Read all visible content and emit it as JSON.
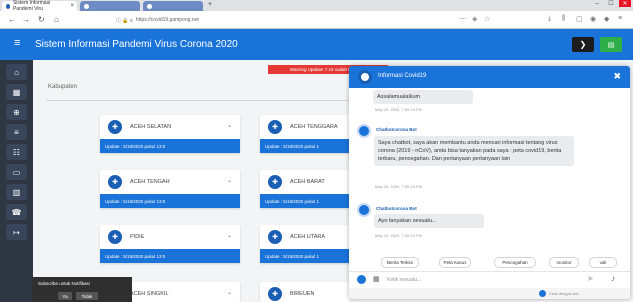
{
  "browser": {
    "tabs": [
      {
        "label": "Sistem Informasi Pandemi Viru"
      },
      {
        "label": ""
      },
      {
        "label": ""
      }
    ],
    "url": "https://covid19.gampong.net",
    "url_prefix": "ⓘ 🔒 ≡",
    "window_controls": [
      "–",
      "☐",
      "✕"
    ]
  },
  "header": {
    "title": "Sistem Informasi Pandemi Virus Corona 2020",
    "btn1_icon": "❯",
    "btn2_icon": "▤"
  },
  "sidebar": {
    "items": [
      {
        "icon": "⌂"
      },
      {
        "icon": "▦"
      },
      {
        "icon": "⊕"
      },
      {
        "icon": "≡"
      },
      {
        "icon": "☷"
      },
      {
        "icon": "▭"
      },
      {
        "icon": "▥"
      },
      {
        "icon": "☎"
      },
      {
        "icon": "↦"
      }
    ]
  },
  "main": {
    "warning": "Warning Update! 7.19 sudah terdata...",
    "kabupaten_label": "Kabupaten",
    "cards": [
      {
        "name": "ACEH SELATAN",
        "update": "Update : 5/19/2020 pukul 13:0"
      },
      {
        "name": "ACEH TENGGARA",
        "update": "Update : 5/19/2020 pukul 1"
      },
      {
        "name": "ACEH TENGAH",
        "update": "Update : 5/19/2020 pukul 13:0"
      },
      {
        "name": "ACEH BARAT",
        "update": "Update : 5/19/2020 pukul 1"
      },
      {
        "name": "PIDIE",
        "update": "Update : 5/19/2020 pukul 13:0"
      },
      {
        "name": "ACEH UTARA",
        "update": "Update : 5/19/2020 pukul 1"
      },
      {
        "name": "ACEH SINGKIL",
        "update": ""
      },
      {
        "name": "BIREUEN",
        "update": ""
      }
    ]
  },
  "notification": {
    "text": "Subscribe untuk Notifikasi",
    "yes": "Ya",
    "no": "Tidak"
  },
  "chat": {
    "title": "Informasi Covid19",
    "messages": [
      {
        "text": "Assalamualaikum",
        "time": "May 20, 2020, 7:30:23 PM"
      },
      {
        "sender": "Chatbotcorona Bot",
        "text": "Saya chatbot, saya akan membantu anda mencari informasi tentang virus corona (2019 - nCoV), anda bisa tanyakan pada saya : peta covid19, berita terbaru, pencegahan. Dan pertanyaan pertanyaan lain",
        "time": "May 20, 2020, 7:30:23 PM"
      },
      {
        "sender": "Chatbotcorona Bot",
        "text": "Ayo tanyakan sesuatu...",
        "time": "May 20, 2020, 7:30:23 PM"
      }
    ],
    "suggestions": [
      "Berita Terkini",
      "Peta Kasus",
      "Pencegahan",
      "monitor",
      "vali"
    ],
    "input_placeholder": "Ketik sesuatu...",
    "footer_text": "Chat dengan bot"
  },
  "colors": {
    "primary": "#1a73d9",
    "sidebar": "#2e3644",
    "warning": "#e53935",
    "success": "#2eaf4a"
  }
}
